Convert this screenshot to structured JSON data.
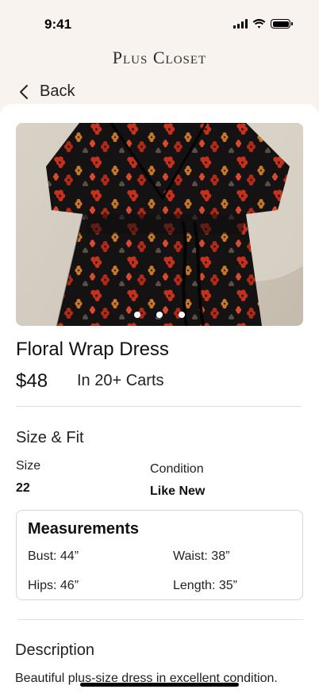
{
  "status_bar": {
    "time": "9:41"
  },
  "brand": {
    "name": "Plus Closet"
  },
  "nav": {
    "back_label": "Back"
  },
  "product": {
    "title": "Floral Wrap Dress",
    "price": "$48",
    "carts": "In 20+ Carts",
    "image_count": 3,
    "active_image_index": 0
  },
  "size_fit": {
    "heading": "Size & Fit",
    "size_label": "Size",
    "size_value": "22",
    "condition_label": "Condition",
    "condition_value": "Like New"
  },
  "measurements": {
    "title": "Measurements",
    "bust": "Bust: 44”",
    "waist": "Waist: 38”",
    "hips": "Hips: 46”",
    "length": "Length: 35”"
  },
  "description": {
    "heading": "Description",
    "text": "Beautiful plus-size dress in excellent condition."
  },
  "colors": {
    "background": "#f8f3ef",
    "card": "#ffffff",
    "dress": "#121212",
    "flower_red": "#c4321e",
    "flower_orange": "#c9782a"
  }
}
